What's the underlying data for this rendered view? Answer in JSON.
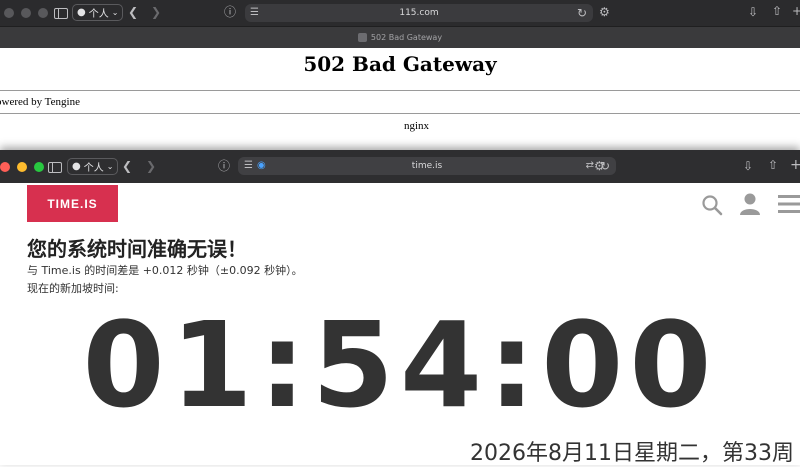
{
  "back_window": {
    "profile_label": "个人",
    "address": "115.com",
    "tab_title": "502 Bad Gateway",
    "page": {
      "heading": "502 Bad Gateway",
      "powered_by": "owered by Tengine",
      "server": "nginx"
    }
  },
  "front_window": {
    "profile_label": "个人",
    "address": "time.is",
    "site": {
      "logo_text": "TIME.IS",
      "headline": "您的系统时间准确无误！",
      "offset_line": "与 Time.is 的时间差是 +0.012 秒钟（±0.092 秒钟）。",
      "location_line": "现在的新加坡时间:",
      "clock": "01:54:00",
      "date_line": "2026年8月11日星期二，第33周"
    }
  },
  "colors": {
    "logo_red": "#d7304f",
    "traffic_red": "#ff5f57",
    "traffic_yellow": "#febc2e",
    "traffic_green": "#28c840"
  },
  "icons": [
    "sidebar-icon",
    "person-icon",
    "chevron-down-icon",
    "back-icon",
    "forward-icon",
    "info-icon",
    "reader-icon",
    "reload-icon",
    "settings-icon",
    "download-icon",
    "share-icon",
    "new-tab-icon",
    "search-icon",
    "user-icon",
    "menu-icon",
    "translate-icon"
  ]
}
